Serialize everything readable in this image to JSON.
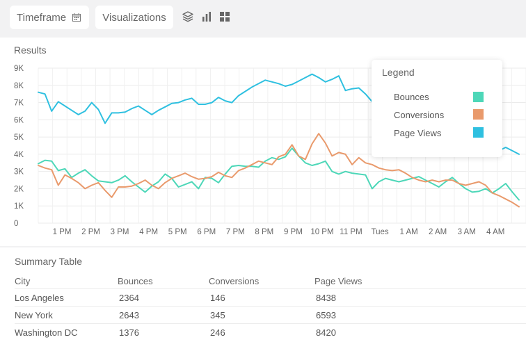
{
  "toolbar": {
    "timeframe_label": "Timeframe",
    "timeframe_icon": "calendar-icon",
    "visualizations_label": "Visualizations",
    "icons": [
      "layers-icon",
      "bar-chart-icon",
      "grid-icon"
    ]
  },
  "results": {
    "title": "Results"
  },
  "chart_data": {
    "type": "line",
    "y_ticks": [
      "9K",
      "8K",
      "7K",
      "6K",
      "5K",
      "4K",
      "3K",
      "2K",
      "1K",
      "0"
    ],
    "x_ticks": [
      "1 PM",
      "2 PM",
      "3 PM",
      "4 PM",
      "5 PM",
      "6 PM",
      "7 PM",
      "8 PM",
      "9 PM",
      "10 PM",
      "11 PM",
      "Tues",
      "1 AM",
      "2 AM",
      "3 AM",
      "4 AM"
    ],
    "ylim": [
      0,
      9000
    ],
    "grid": true,
    "legend_placement": "top-right",
    "series": [
      {
        "name": "Page Views",
        "color": "#2fc0e0",
        "values": [
          7600,
          7500,
          6500,
          7050,
          6800,
          6550,
          6300,
          6500,
          7000,
          6600,
          5800,
          6400,
          6400,
          6450,
          6650,
          6800,
          6550,
          6300,
          6550,
          6750,
          6950,
          7000,
          7150,
          7250,
          6900,
          6900,
          7000,
          7300,
          7100,
          7000,
          7400,
          7650,
          7900,
          8100,
          8300,
          8200,
          8100,
          7950,
          8050,
          8250,
          8450,
          8650,
          8450,
          8200,
          8350,
          8550,
          7700,
          7800,
          7850,
          7500,
          7050,
          6500,
          6500,
          6300,
          6300,
          6400,
          6350,
          6300,
          6300,
          6300,
          5900,
          5700,
          5600,
          5400,
          5300,
          5100,
          4900,
          4700,
          4500,
          4200,
          4400,
          4200,
          4000
        ]
      },
      {
        "name": "Bounces",
        "color": "#4dd7b8",
        "values": [
          3450,
          3650,
          3600,
          3050,
          3150,
          2650,
          2900,
          3100,
          2750,
          2450,
          2400,
          2350,
          2500,
          2750,
          2400,
          2100,
          1800,
          2150,
          2400,
          2850,
          2600,
          2100,
          2250,
          2400,
          2000,
          2650,
          2600,
          2350,
          2850,
          3300,
          3350,
          3300,
          3300,
          3250,
          3600,
          3800,
          3700,
          3850,
          4350,
          3900,
          3500,
          3350,
          3450,
          3600,
          3000,
          2850,
          3000,
          2900,
          2850,
          2800,
          2000,
          2400,
          2600,
          2500,
          2400,
          2500,
          2600,
          2700,
          2500,
          2300,
          2100,
          2400,
          2650,
          2300,
          2000,
          1800,
          1850,
          2000,
          1750,
          2000,
          2300,
          1800,
          1350
        ]
      },
      {
        "name": "Conversions",
        "color": "#e99a6c",
        "values": [
          3350,
          3200,
          3100,
          2200,
          2800,
          2600,
          2350,
          2000,
          2200,
          2350,
          1900,
          1500,
          2100,
          2100,
          2150,
          2300,
          2500,
          2200,
          2000,
          2350,
          2600,
          2750,
          2900,
          2700,
          2550,
          2600,
          2700,
          2950,
          2750,
          2650,
          3050,
          3200,
          3400,
          3600,
          3500,
          3400,
          3850,
          4000,
          4550,
          3900,
          3700,
          4600,
          5200,
          4650,
          3900,
          4100,
          4000,
          3400,
          3800,
          3500,
          3400,
          3200,
          3100,
          3050,
          3100,
          2900,
          2650,
          2500,
          2400,
          2500,
          2400,
          2500,
          2500,
          2300,
          2200,
          2300,
          2400,
          2200,
          1750,
          1600,
          1400,
          1200,
          950
        ]
      }
    ]
  },
  "legend": {
    "title": "Legend",
    "items": [
      {
        "label": "Bounces",
        "color": "#4dd7b8"
      },
      {
        "label": "Conversions",
        "color": "#e99a6c"
      },
      {
        "label": "Page Views",
        "color": "#2fc0e0"
      }
    ]
  },
  "summary": {
    "title": "Summary Table",
    "columns": [
      "City",
      "Bounces",
      "Conversions",
      "Page Views"
    ],
    "rows": [
      [
        "Los Angeles",
        "2364",
        "146",
        "8438"
      ],
      [
        "New York",
        "2643",
        "345",
        "6593"
      ],
      [
        "Washington DC",
        "1376",
        "246",
        "8420"
      ]
    ]
  }
}
